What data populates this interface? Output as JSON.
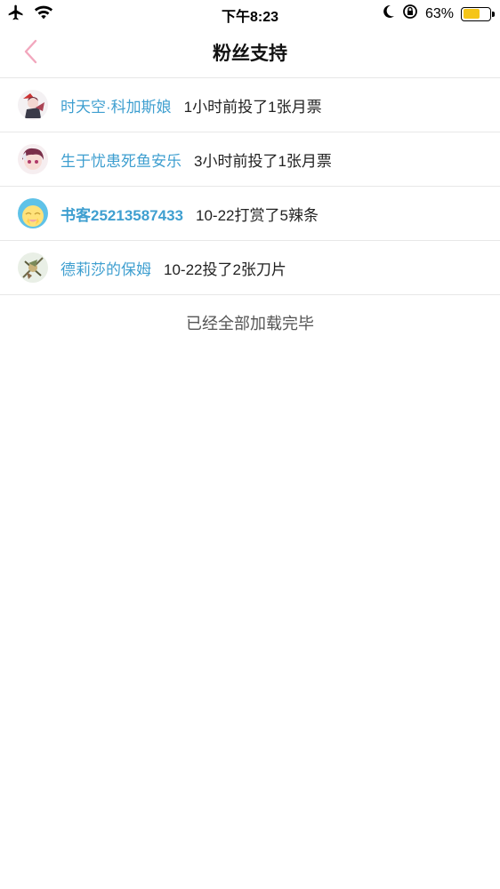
{
  "status_bar": {
    "time": "下午8:23",
    "battery_percent": "63%",
    "battery_level": 0.63,
    "battery_color": "#f5c518",
    "icons": [
      "airplane-icon",
      "wifi-icon",
      "moon-icon",
      "rotation-lock-icon",
      "battery-icon"
    ]
  },
  "nav": {
    "title": "粉丝支持",
    "back_icon": "chevron-left-icon",
    "accent": "#f2a7bd"
  },
  "supporters": [
    {
      "name": "时天空·科加斯娘",
      "action": "1小时前投了1张月票",
      "avatar": "avatar-anime-girl"
    },
    {
      "name": "生于忧患死鱼安乐",
      "action": "3小时前投了1张月票",
      "avatar": "avatar-purple-hair"
    },
    {
      "name": "书客25213587433",
      "action": "10-22打赏了5辣条",
      "avatar": "avatar-yellow-face"
    },
    {
      "name": "德莉莎的保姆",
      "action": "10-22投了2张刀片",
      "avatar": "avatar-character"
    }
  ],
  "end_message": "已经全部加载完毕",
  "colors": {
    "name_link": "#3f9fd0",
    "divider": "#e8e8e8"
  }
}
